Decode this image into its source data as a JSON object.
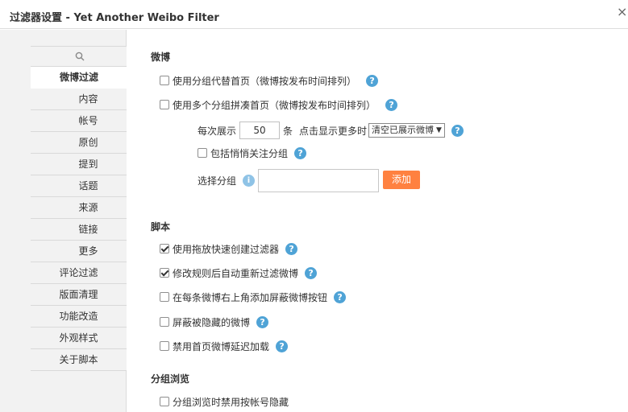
{
  "dialog": {
    "title": "过滤器设置 - Yet Another Weibo Filter",
    "close": "×"
  },
  "sidebar": {
    "items": [
      {
        "label": "微博过滤"
      },
      {
        "label": "内容"
      },
      {
        "label": "帐号"
      },
      {
        "label": "原创"
      },
      {
        "label": "提到"
      },
      {
        "label": "话题"
      },
      {
        "label": "来源"
      },
      {
        "label": "链接"
      },
      {
        "label": "更多"
      },
      {
        "label": "评论过滤"
      },
      {
        "label": "版面清理"
      },
      {
        "label": "功能改造"
      },
      {
        "label": "外观样式"
      },
      {
        "label": "关于脚本"
      }
    ]
  },
  "weibo": {
    "title": "微博",
    "opt1": "使用分组代替首页（微博按发布时间排列）",
    "opt2": "使用多个分组拼凑首页（微博按发布时间排列）",
    "per_show_prefix": "每次展示",
    "per_show_value": "50",
    "per_show_unit": "条",
    "click_more": "点击显示更多时",
    "select_value": "清空已展示微博",
    "include_quiet": "包括悄悄关注分组",
    "choose_group": "选择分组",
    "add_button": "添加"
  },
  "script": {
    "title": "脚本",
    "opt1": "使用拖放快速创建过滤器",
    "opt2": "修改规则后自动重新过滤微博",
    "opt3": "在每条微博右上角添加屏蔽微博按钮",
    "opt4": "屏蔽被隐藏的微博",
    "opt5": "禁用首页微博延迟加载"
  },
  "group_browse": {
    "title": "分组浏览",
    "opt1": "分组浏览时禁用按帐号隐藏"
  },
  "help_glyph": "?",
  "info_glyph": "i"
}
